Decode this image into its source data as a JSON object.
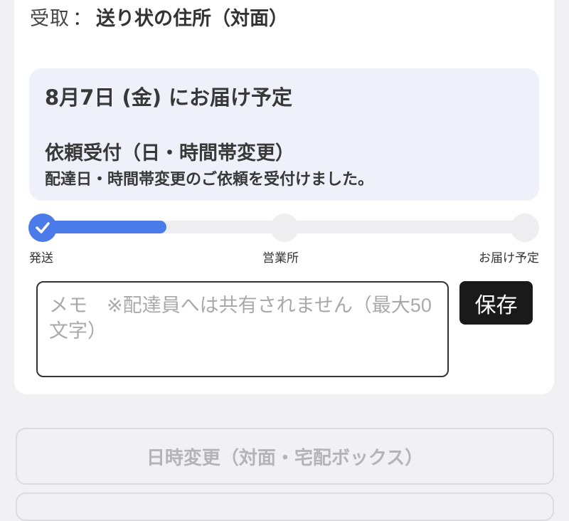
{
  "receive": {
    "label": "受取",
    "separator": "：",
    "value": "送り状の住所（対面）"
  },
  "delivery": {
    "date_text": "8月7日 (金) にお届け予定",
    "status_title": "依頼受付（日・時間帯変更）",
    "status_description": "配達日・時間帯変更のご依頼を受付けました。"
  },
  "progress": {
    "fraction": 0.27,
    "steps": [
      {
        "label": "発送",
        "state": "done"
      },
      {
        "label": "営業所",
        "state": "pending"
      },
      {
        "label": "お届け予定",
        "state": "pending"
      }
    ],
    "active_color": "#4a7be8",
    "inactive_color": "#eeeef1"
  },
  "memo": {
    "placeholder": "メモ　※配達員へは共有されません（最大50文字）",
    "value": ""
  },
  "buttons": {
    "save_label": "保存",
    "change_datetime_label": "日時変更（対面・宅配ボックス）"
  },
  "icons": {
    "step_done": "checkmark-icon"
  }
}
